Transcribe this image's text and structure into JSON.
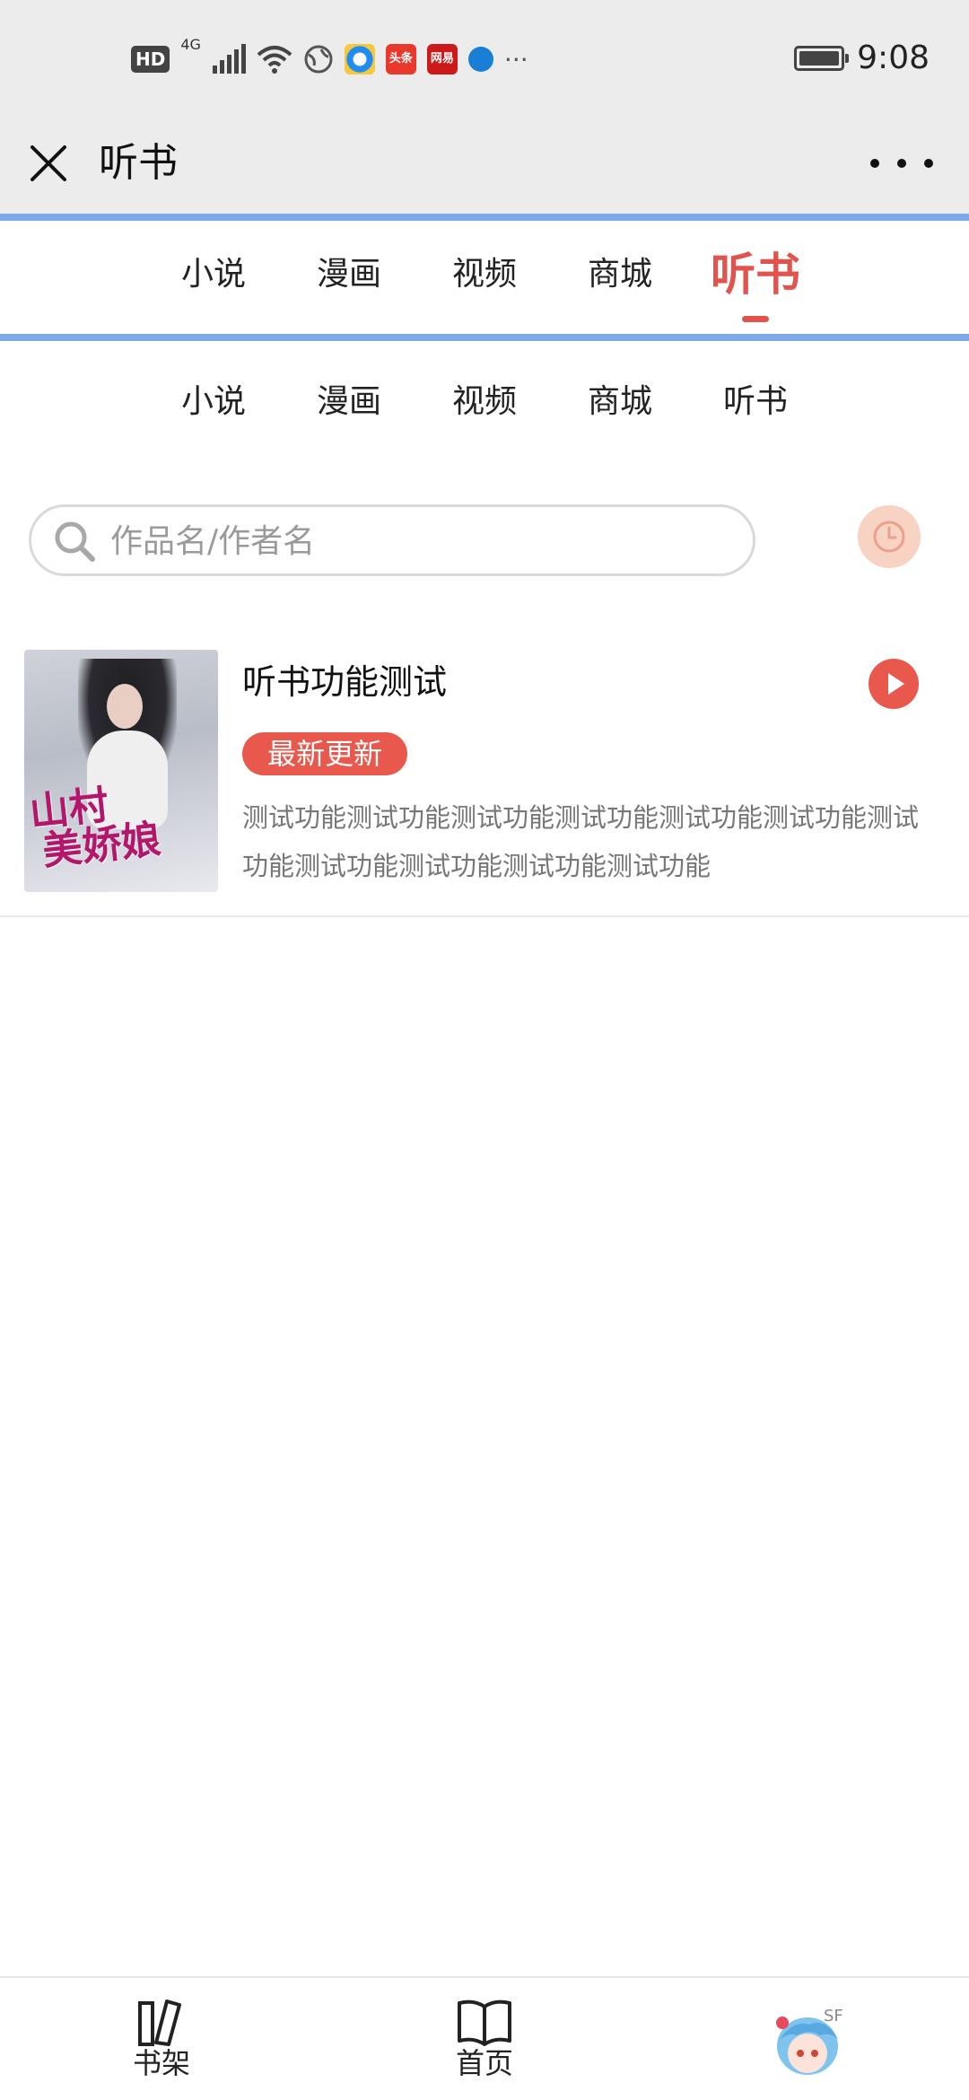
{
  "status_bar": {
    "hd": "HD",
    "network": "4G",
    "more": "···",
    "time": "9:08",
    "app_icons": [
      {
        "name": "browser-globe-icon"
      },
      {
        "name": "qq-browser-icon",
        "color": "#1e8cf0"
      },
      {
        "name": "toutiao-icon",
        "text": "头条",
        "color": "#e8392c"
      },
      {
        "name": "netease-icon",
        "text": "网易",
        "color": "#cc1a1a"
      },
      {
        "name": "browser-icon",
        "color": "#1a7fd4"
      }
    ]
  },
  "header": {
    "title": "听书"
  },
  "nav_primary": {
    "tabs": [
      {
        "label": "小说"
      },
      {
        "label": "漫画"
      },
      {
        "label": "视频"
      },
      {
        "label": "商城"
      },
      {
        "label": "听书",
        "active": true
      }
    ]
  },
  "nav_secondary": {
    "tabs": [
      {
        "label": "小说"
      },
      {
        "label": "漫画"
      },
      {
        "label": "视频"
      },
      {
        "label": "商城"
      },
      {
        "label": "听书"
      }
    ]
  },
  "search": {
    "placeholder": "作品名/作者名",
    "value": ""
  },
  "books": [
    {
      "cover_title_line1": "山村",
      "cover_title_line2": "美娇娘",
      "title": "听书功能测试",
      "badge": "最新更新",
      "description": "测试功能测试功能测试功能测试功能测试功能测试功能测试功能测试功能测试功能测试功能测试功能"
    }
  ],
  "bottom_nav": {
    "items": [
      {
        "label": "书架",
        "icon": "bookshelf-icon"
      },
      {
        "label": "首页",
        "icon": "open-book-icon"
      },
      {
        "label": "",
        "icon": "avatar"
      }
    ]
  },
  "colors": {
    "accent": "#e0544d",
    "badge": "#e9584c",
    "divider_blue": "#7fa8e8",
    "history_button": "#f8d3c4"
  }
}
